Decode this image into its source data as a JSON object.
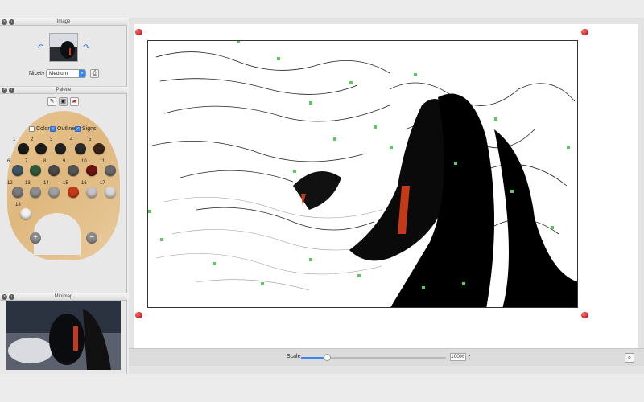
{
  "panels": {
    "image": {
      "title": "Image"
    },
    "palette": {
      "title": "Palette"
    },
    "minimap": {
      "title": "Minimap"
    }
  },
  "image_panel": {
    "nicety_label": "Nicety",
    "nicety_value": "Medium",
    "rotate_left_icon": "rotate-left-icon",
    "rotate_right_icon": "rotate-right-icon"
  },
  "palette": {
    "toggles": [
      {
        "label": "Colors",
        "checked": false
      },
      {
        "label": "Outlines",
        "checked": true
      },
      {
        "label": "Signs",
        "checked": true
      }
    ],
    "swatches": [
      {
        "num": "1",
        "color": "#1a1a1a"
      },
      {
        "num": "2",
        "color": "#1e1e1e"
      },
      {
        "num": "3",
        "color": "#232323"
      },
      {
        "num": "4",
        "color": "#2a2a2a"
      },
      {
        "num": "5",
        "color": "#3a2418"
      },
      {
        "num": "6",
        "color": "#3d5566"
      },
      {
        "num": "7",
        "color": "#2f5a3a"
      },
      {
        "num": "8",
        "color": "#4a4a4a"
      },
      {
        "num": "9",
        "color": "#555555"
      },
      {
        "num": "10",
        "color": "#6b1410"
      },
      {
        "num": "11",
        "color": "#6a6a6a"
      },
      {
        "num": "12",
        "color": "#7a7a7a"
      },
      {
        "num": "13",
        "color": "#8d8d8d"
      },
      {
        "num": "14",
        "color": "#a0a0a0"
      },
      {
        "num": "15",
        "color": "#c43a16"
      },
      {
        "num": "16",
        "color": "#c9c0c3"
      },
      {
        "num": "17",
        "color": "#d8d8d8"
      },
      {
        "num": "18",
        "color": "#f2f2f2"
      }
    ]
  },
  "scale": {
    "label": "Scale",
    "value": "100%",
    "fraction": 0.18
  },
  "colors": {
    "accent": "#3b86f3",
    "pin": "#c00000",
    "sign_marker": "#5ec85e"
  }
}
